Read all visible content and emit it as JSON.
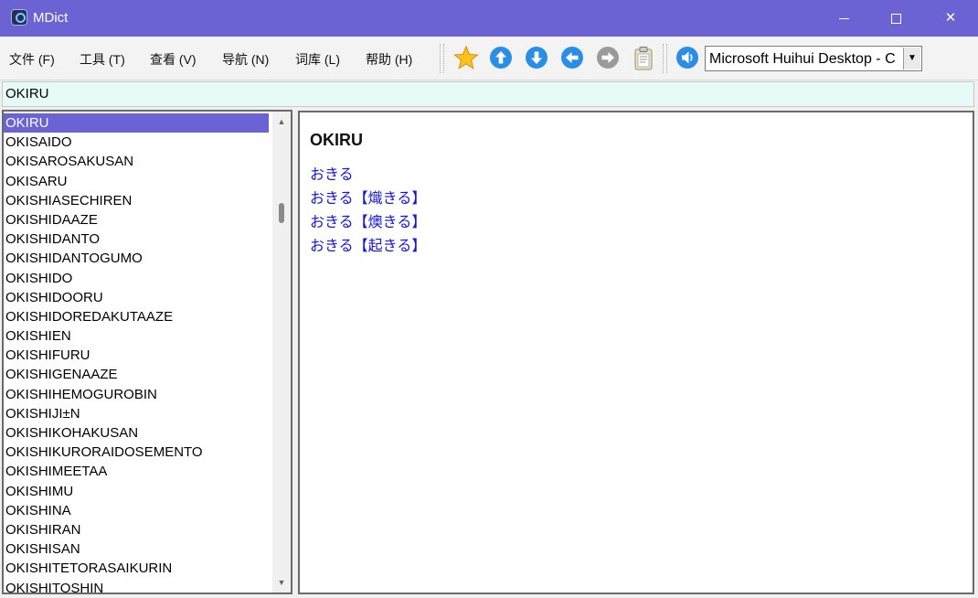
{
  "window": {
    "title": "MDict"
  },
  "menu": [
    {
      "label": "文件 (F)"
    },
    {
      "label": "工具 (T)"
    },
    {
      "label": "查看 (V)"
    },
    {
      "label": "导航 (N)"
    },
    {
      "label": "词库 (L)"
    },
    {
      "label": "帮助 (H)"
    }
  ],
  "toolbar": {
    "icons": [
      "star-icon",
      "arrow-up-icon",
      "arrow-down-icon",
      "arrow-left-icon",
      "arrow-right-icon",
      "clipboard-icon",
      "speaker-icon"
    ],
    "voice_select": "Microsoft Huihui Desktop - C"
  },
  "search": {
    "value": "OKIRU"
  },
  "word_list": {
    "selected_index": 0,
    "items": [
      "OKIRU",
      "OKISAIDO",
      "OKISAROSAKUSAN",
      "OKISARU",
      "OKISHIASECHIREN",
      "OKISHIDAAZE",
      "OKISHIDANTO",
      "OKISHIDANTOGUMO",
      "OKISHIDO",
      "OKISHIDOORU",
      "OKISHIDOREDAKUTAAZE",
      "OKISHIEN",
      "OKISHIFURU",
      "OKISHIGENAAZE",
      "OKISHIHEMOGUROBIN",
      "OKISHIJI±N",
      "OKISHIKOHAKUSAN",
      "OKISHIKURORAIDOSEMENTO",
      "OKISHIMEETAA",
      "OKISHIMU",
      "OKISHINA",
      "OKISHIRAN",
      "OKISHISAN",
      "OKISHITETORASAIKURIN",
      "OKISHITOSHIN"
    ]
  },
  "entry": {
    "headword": "OKIRU",
    "links": [
      "おきる",
      "おきる【熾きる】",
      "おきる【燠きる】",
      "おきる【起きる】"
    ]
  },
  "colors": {
    "accent": "#6b62d4",
    "link": "#1515e0",
    "search_bg": "#e6fbf8"
  }
}
